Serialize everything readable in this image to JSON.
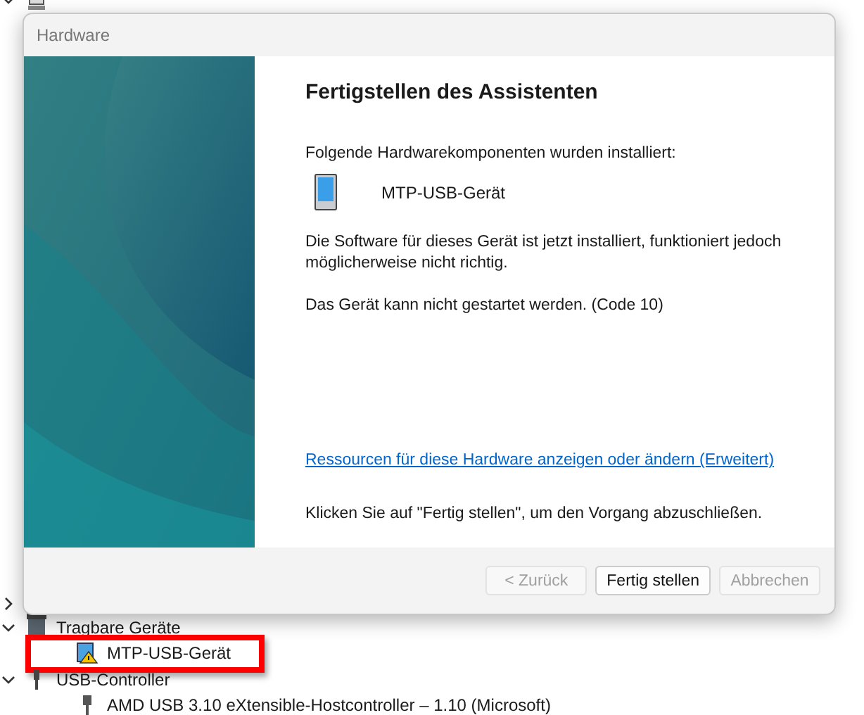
{
  "background_tree": [
    {
      "expanded": true
    },
    {
      "expanded": false
    },
    {
      "label": "Tragbare Geräte",
      "expanded": true,
      "children": [
        {
          "label": "MTP-USB-Gerät",
          "warning": true,
          "highlighted": true
        }
      ]
    },
    {
      "label": "USB-Controller",
      "expanded": true,
      "children": [
        {
          "label": "AMD USB 3.10 eXtensible-Hostcontroller – 1.10 (Microsoft)",
          "warning": false,
          "highlighted": false
        }
      ]
    }
  ],
  "dialog": {
    "title": "Hardware",
    "heading": "Fertigstellen des Assistenten",
    "intro": "Folgende Hardwarekomponenten wurden installiert:",
    "device": "MTP-USB-Gerät",
    "status": "Die Software für dieses Gerät ist jetzt installiert, funktioniert jedoch möglicherweise nicht richtig.",
    "error": "Das Gerät kann nicht gestartet werden. (Code 10)",
    "link": "Ressourcen für diese Hardware anzeigen oder ändern (Erweitert)",
    "finish_hint": "Klicken Sie auf \"Fertig stellen\", um den Vorgang abzuschließen.",
    "buttons": [
      {
        "label": "< Zurück",
        "disabled": true
      },
      {
        "label": "Fertig stellen",
        "disabled": false
      },
      {
        "label": "Abbrechen",
        "disabled": true
      }
    ]
  }
}
